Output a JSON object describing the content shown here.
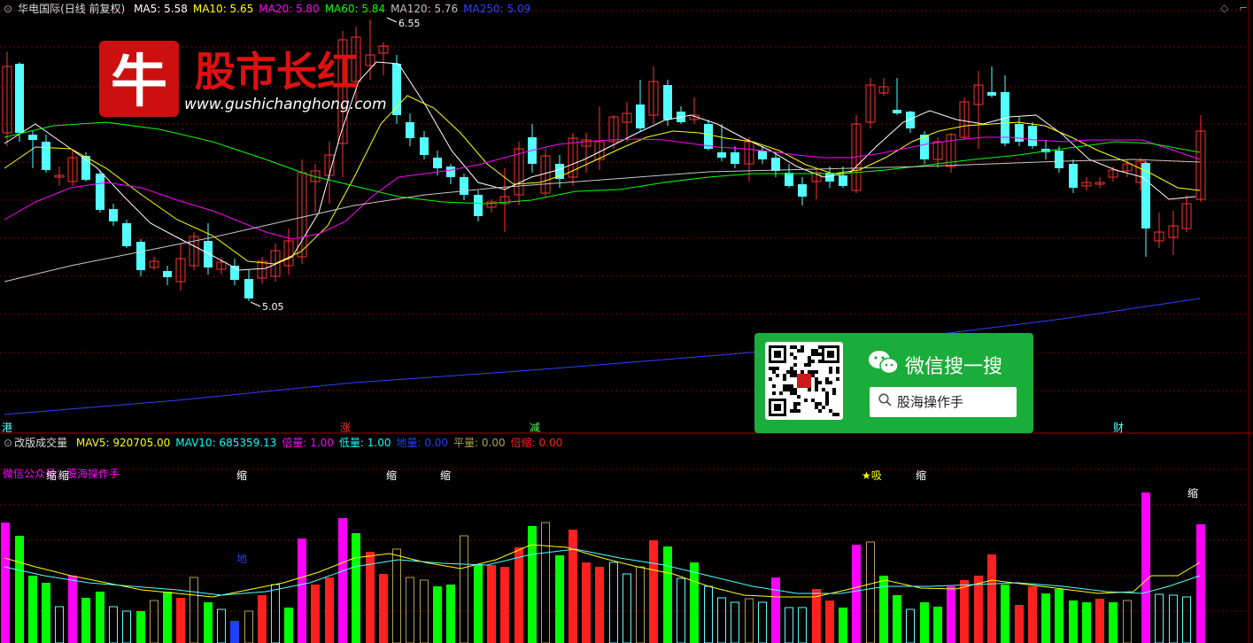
{
  "header": {
    "title": "华电国际(日线 前复权)",
    "ma": [
      {
        "label": "MA5: 5.58",
        "color": "#ffffff"
      },
      {
        "label": "MA10: 5.65",
        "color": "#ffff00"
      },
      {
        "label": "MA20: 5.80",
        "color": "#ff00ff"
      },
      {
        "label": "MA60: 5.84",
        "color": "#00ff00"
      },
      {
        "label": "MA120: 5.76",
        "color": "#c0c0c0"
      },
      {
        "label": "MA250: 5.09",
        "color": "#3040ff"
      }
    ]
  },
  "annotations": {
    "high": "6.55",
    "low": "5.05"
  },
  "event_markers": [
    "港",
    "涨",
    "减",
    "财"
  ],
  "volume_header": {
    "title": "改版成交量",
    "items": [
      {
        "label": "MAV5: 920705.00",
        "color": "#ffff00"
      },
      {
        "label": "MAV10: 685359.13",
        "color": "#00ffff"
      },
      {
        "label": "倍量: 1.00",
        "color": "#ff00ff"
      },
      {
        "label": "低量: 1.00",
        "color": "#00ffff"
      },
      {
        "label": "地量: 0.00",
        "color": "#2040ff"
      },
      {
        "label": "平量: 0.00",
        "color": "#b0a050"
      },
      {
        "label": "倍缩: 0.00",
        "color": "#ff2020"
      }
    ]
  },
  "volume_tags": {
    "wechat_label": "微信公众号：股海操作手",
    "shrink": "缩",
    "absorb": "★吸",
    "ground": "地"
  },
  "watermark": {
    "logo_char": "牛",
    "title": "股市长红",
    "url": "www.gushichanghong.com"
  },
  "wechat_card": {
    "title": "微信搜一搜",
    "search_text": "股海操作手",
    "search_icon": "search-icon"
  },
  "colors": {
    "up": "#ff3232",
    "down": "#54ffff",
    "grid": "#800000",
    "bg": "#000000"
  }
}
